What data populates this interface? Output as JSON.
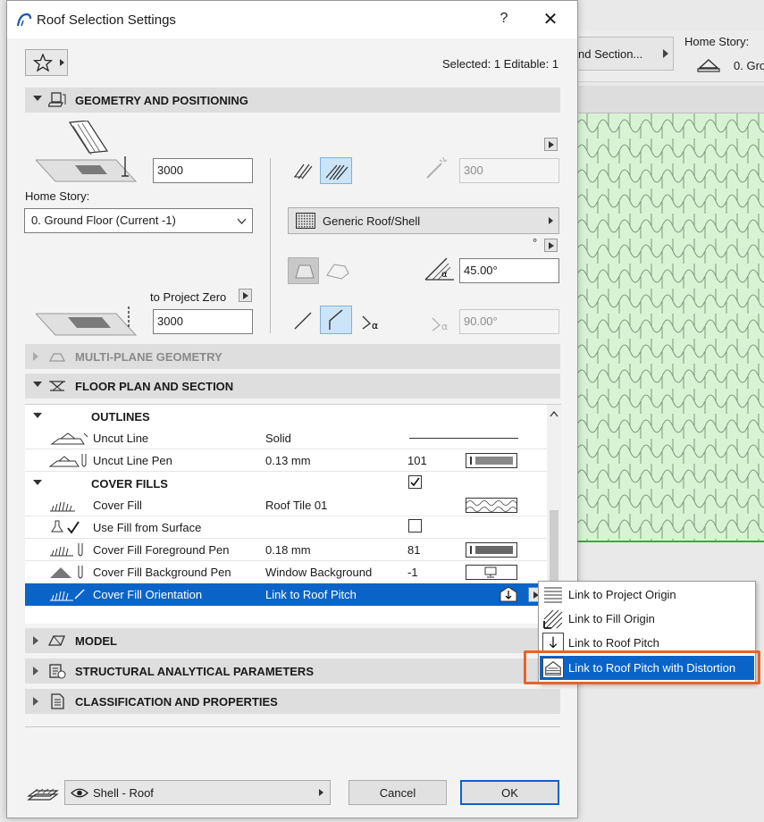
{
  "background": {
    "section_button": "nd Section...",
    "home_story_label": "Home Story:",
    "home_story_value": "0. Gro"
  },
  "dialog": {
    "title": "Roof Selection Settings",
    "help": "?",
    "close": "✕",
    "selected_status": "Selected: 1 Editable: 1"
  },
  "geometry": {
    "header": "GEOMETRY AND POSITIONING",
    "top_offset": "3000",
    "home_story_label": "Home Story:",
    "home_story_value": "0. Ground Floor (Current -1)",
    "to_project_zero_label": "to Project Zero",
    "elevation": "3000",
    "thickness": "300",
    "structure": "Generic Roof/Shell",
    "degree_symbol": "°",
    "pitch_angle": "45.00°",
    "edge_angle": "90.00°"
  },
  "sections": {
    "multiplane": "MULTI-PLANE GEOMETRY",
    "floor_plan": "FLOOR PLAN AND SECTION",
    "model": "MODEL",
    "structural": "STRUCTURAL ANALYTICAL PARAMETERS",
    "classification": "CLASSIFICATION AND PROPERTIES"
  },
  "table": {
    "outlines_group": "OUTLINES",
    "cover_fills_group": "COVER FILLS",
    "rows": [
      {
        "name": "Uncut Line",
        "value": "Solid",
        "num": ""
      },
      {
        "name": "Uncut Line Pen",
        "value": "0.13 mm",
        "num": "101"
      },
      {
        "name": "Cover Fill",
        "value": "Roof Tile 01",
        "num": ""
      },
      {
        "name": "Use Fill from Surface",
        "value": "",
        "num": ""
      },
      {
        "name": "Cover Fill Foreground Pen",
        "value": "0.18 mm",
        "num": "81"
      },
      {
        "name": "Cover Fill Background Pen",
        "value": "Window Background",
        "num": "-1"
      },
      {
        "name": "Cover Fill Orientation",
        "value": "Link to Roof Pitch",
        "num": ""
      }
    ]
  },
  "popup": {
    "items": [
      {
        "label": "Link to Project Origin"
      },
      {
        "label": "Link to Fill Origin"
      },
      {
        "label": "Link to Roof Pitch"
      },
      {
        "label": "Link to Roof Pitch with Distortion"
      }
    ]
  },
  "footer": {
    "layer_value": "Shell - Roof",
    "cancel": "Cancel",
    "ok": "OK"
  },
  "colors": {
    "accent": "#0a64c8",
    "highlight_box": "#e8622a",
    "canvas_fill": "#d8f3d4",
    "canvas_border": "#33b033"
  }
}
